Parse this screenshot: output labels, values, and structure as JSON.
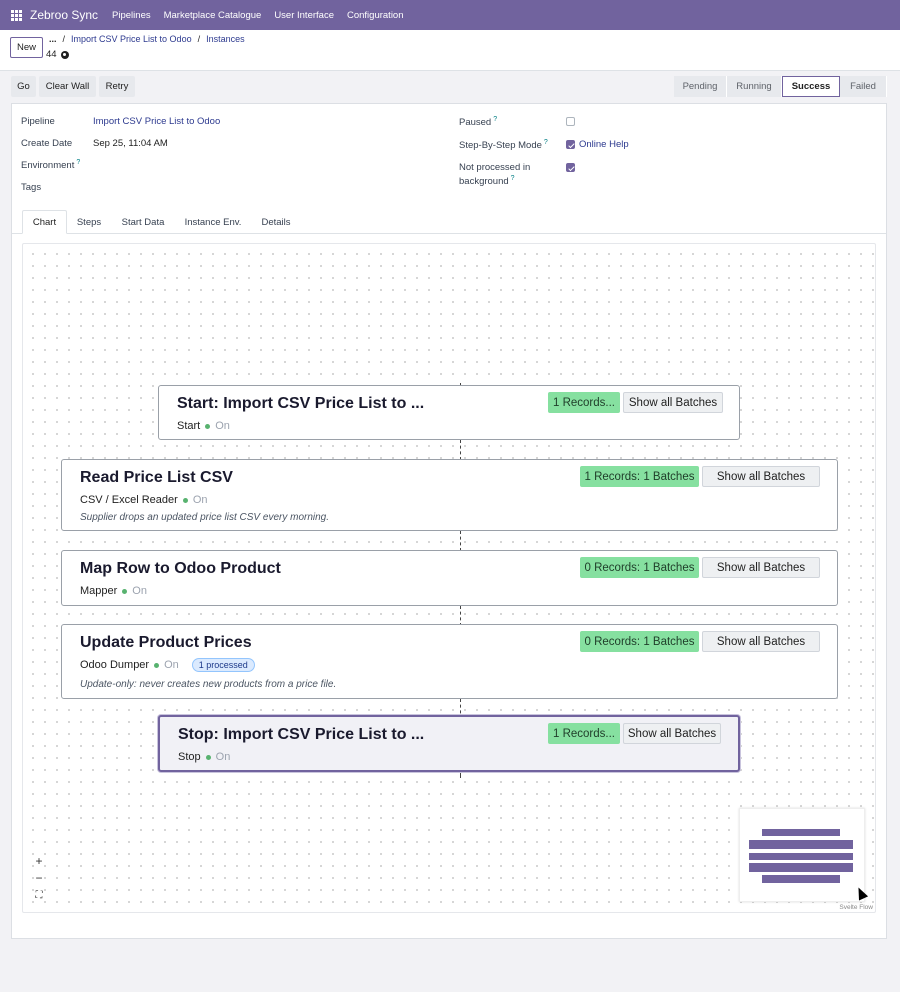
{
  "topnav": {
    "brand": "Zebroo Sync",
    "menu": [
      "Pipelines",
      "Marketplace Catalogue",
      "User Interface",
      "Configuration"
    ]
  },
  "control_panel": {
    "new_label": "New",
    "breadcrumb_dots": "...",
    "breadcrumb": [
      "Import CSV Price List to Odoo",
      "Instances"
    ],
    "record_id": "44"
  },
  "actions": {
    "go": "Go",
    "clear_wall": "Clear Wall",
    "retry": "Retry"
  },
  "statusbar": {
    "stages": [
      "Pending",
      "Running",
      "Success",
      "Failed"
    ],
    "active": "Success"
  },
  "form": {
    "pipeline_label": "Pipeline",
    "pipeline_value": "Import CSV Price List to Odoo",
    "create_date_label": "Create Date",
    "create_date_value": "Sep 25, 11:04 AM",
    "environment_label": "Environment",
    "tags_label": "Tags",
    "paused_label": "Paused",
    "paused": false,
    "step_mode_label": "Step-By-Step Mode",
    "step_mode": true,
    "online_help": "Online Help",
    "not_processed_label_1": "Not processed in",
    "not_processed_label_2": "background",
    "not_processed": true,
    "help_mark": "?"
  },
  "tabs": [
    "Chart",
    "Steps",
    "Start Data",
    "Instance Env.",
    "Details"
  ],
  "flow": {
    "on_label": "On",
    "show_all": "Show all Batches",
    "nodes": [
      {
        "title": "Start: Import CSV Price List to ...",
        "type": "Start",
        "records": "1 Records..."
      },
      {
        "title": "Read Price List CSV",
        "type": "CSV / Excel Reader",
        "records": "1 Records: 1 Batches",
        "description": "Supplier drops an updated price list CSV every morning."
      },
      {
        "title": "Map Row to Odoo Product",
        "type": "Mapper",
        "records": "0 Records: 1 Batches"
      },
      {
        "title": "Update Product Prices",
        "type": "Odoo Dumper",
        "records": "0 Records: 1 Batches",
        "badge": "1 processed",
        "description": "Update-only: never creates new products from a price file."
      },
      {
        "title": "Stop: Import CSV Price List to ...",
        "type": "Stop",
        "records": "1 Records..."
      }
    ],
    "controls": {
      "zoom_in": "+",
      "zoom_out": "−",
      "fit": "⛶"
    },
    "attribution": "Svelte Flow"
  }
}
